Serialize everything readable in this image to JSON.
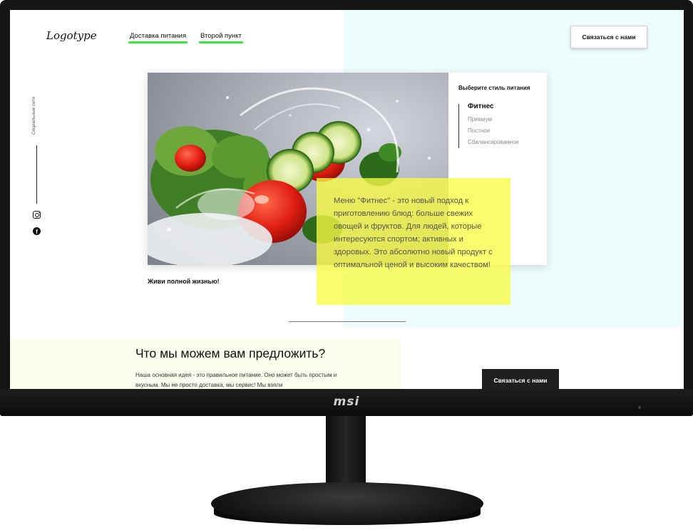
{
  "monitor": {
    "brand": "msi"
  },
  "header": {
    "logo": "Logotype",
    "nav": [
      {
        "label": "Доставка питания"
      },
      {
        "label": "Второй пункт"
      }
    ],
    "contact_button": "Связаться с нами"
  },
  "social": {
    "label": "Социальные сети",
    "icons": [
      "instagram-icon",
      "facebook-icon"
    ],
    "facebook_glyph": "f"
  },
  "style_picker": {
    "title": "Выберите стиль питания",
    "options": [
      "Фитнес",
      "Премиум",
      "Постное",
      "Сбалансированное"
    ],
    "selected": "Фитнес"
  },
  "hero": {
    "description": "Меню \"Фитнес\" - это новый подход к приготовлению блюд: больше свежих овощей и фруктов. Для людей, которые интересуются спортом; активных и здоровых. Это абсолютно новый продукт с оптимальной ценой и высоким качеством!",
    "tagline": "Живи полной жизнью!"
  },
  "offer": {
    "title": "Что мы можем вам предложить?",
    "text": "Наша основная идея - это правильное питание. Оно может быть простым и вкусным. Мы не просто доставка, мы сервис! Мы взяли",
    "contact_button": "Связаться с нами"
  },
  "colors": {
    "accent_green": "#37e83a",
    "highlight_yellow": "#f7fb41",
    "panel_cyan": "#eefcfe",
    "panel_lime": "#fbfdef",
    "dark_button": "#1f1f1f"
  }
}
